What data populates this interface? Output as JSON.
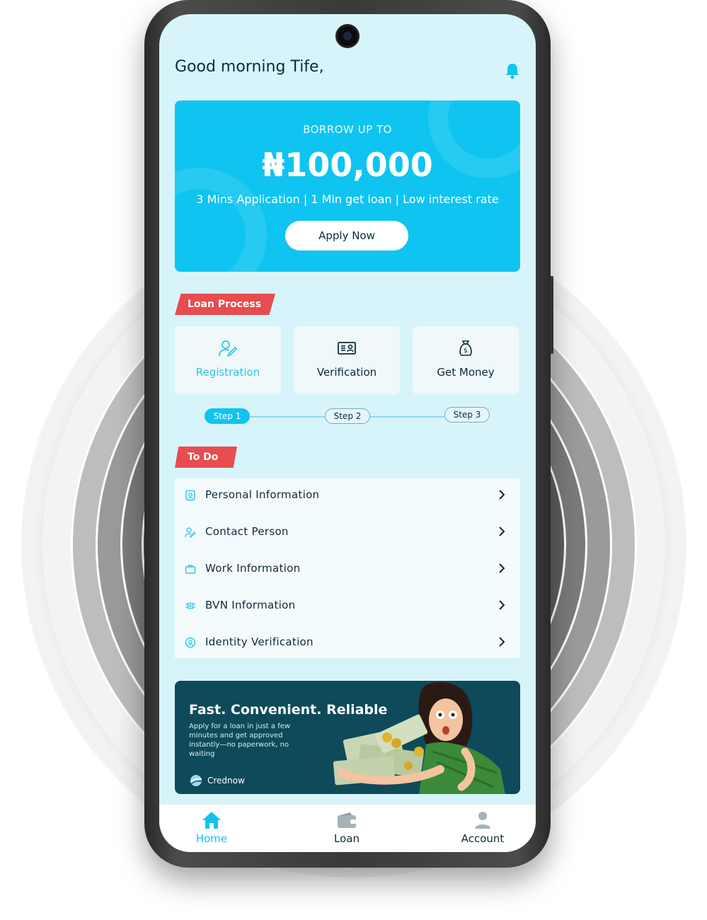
{
  "header": {
    "greeting": "Good morning Tife,"
  },
  "hero": {
    "label": "BORROW UP TO",
    "amount": "₦100,000",
    "subtitle": "3 Mins Application | 1 Min get loan | Low interest rate",
    "apply_label": "Apply Now"
  },
  "loan_process": {
    "tag": "Loan Process",
    "steps": [
      {
        "label": "Registration",
        "icon": "user-edit-icon",
        "step": "Step 1",
        "active": true
      },
      {
        "label": "Verification",
        "icon": "id-card-icon",
        "step": "Step 2",
        "active": false
      },
      {
        "label": "Get Money",
        "icon": "money-bag-icon",
        "step": "Step 3",
        "active": false
      }
    ]
  },
  "todo": {
    "tag": "To Do",
    "items": [
      {
        "label": "Personal Information",
        "icon": "profile-icon"
      },
      {
        "label": "Contact Person",
        "icon": "user-edit-icon"
      },
      {
        "label": "Work Information",
        "icon": "briefcase-icon"
      },
      {
        "label": "BVN Information",
        "icon": "chip-icon"
      },
      {
        "label": "Identity Verification",
        "icon": "face-id-icon"
      }
    ]
  },
  "banner": {
    "title": "Fast. Convenient. Reliable",
    "description": "Apply for a loan in just a few minutes and get approved instantly—no paperwork, no waiting",
    "brand": "Crednow"
  },
  "nav": {
    "items": [
      {
        "label": "Home",
        "icon": "home-icon",
        "active": true
      },
      {
        "label": "Loan",
        "icon": "wallet-icon",
        "active": false
      },
      {
        "label": "Account",
        "icon": "person-icon",
        "active": false
      }
    ]
  },
  "colors": {
    "accent": "#0fc4f0",
    "tag": "#e84c4f",
    "screen_bg": "#d8f4fb",
    "banner_bg": "#0e4a5a",
    "text": "#0d2b3a"
  }
}
